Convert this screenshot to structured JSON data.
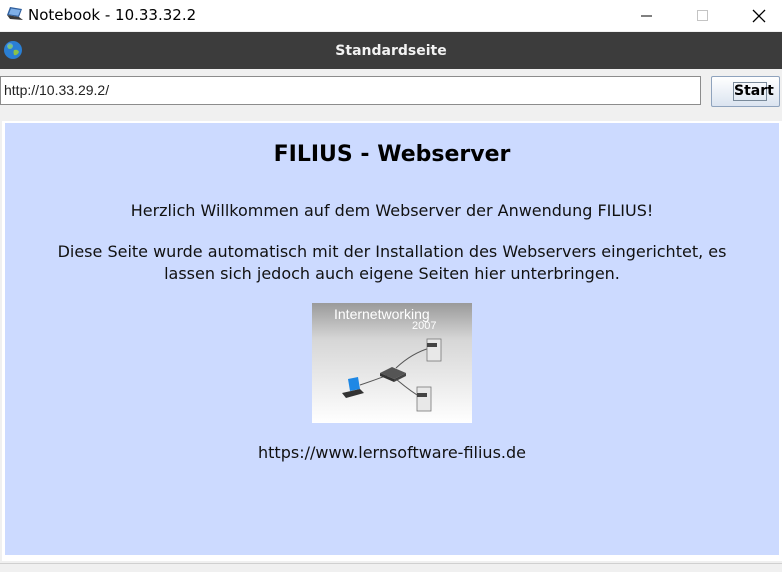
{
  "window": {
    "title": "Notebook - 10.33.32.2"
  },
  "header": {
    "title": "Standardseite"
  },
  "toolbar": {
    "address": "http://10.33.29.2/",
    "start_label": "Start"
  },
  "page": {
    "heading": "FILIUS - Webserver",
    "welcome": "Herzlich Willkommen auf dem Webserver der Anwendung FILIUS!",
    "info_line1": "Diese Seite wurde automatisch mit der Installation des Webservers eingerichtet, es",
    "info_line2": "lassen sich jedoch auch eigene Seiten hier unterbringen.",
    "image_caption": "Internetworking",
    "image_year": "2007",
    "url": "https://www.lernsoftware-filius.de"
  },
  "icons": {
    "app": "notebook-icon",
    "globe": "globe-icon"
  }
}
